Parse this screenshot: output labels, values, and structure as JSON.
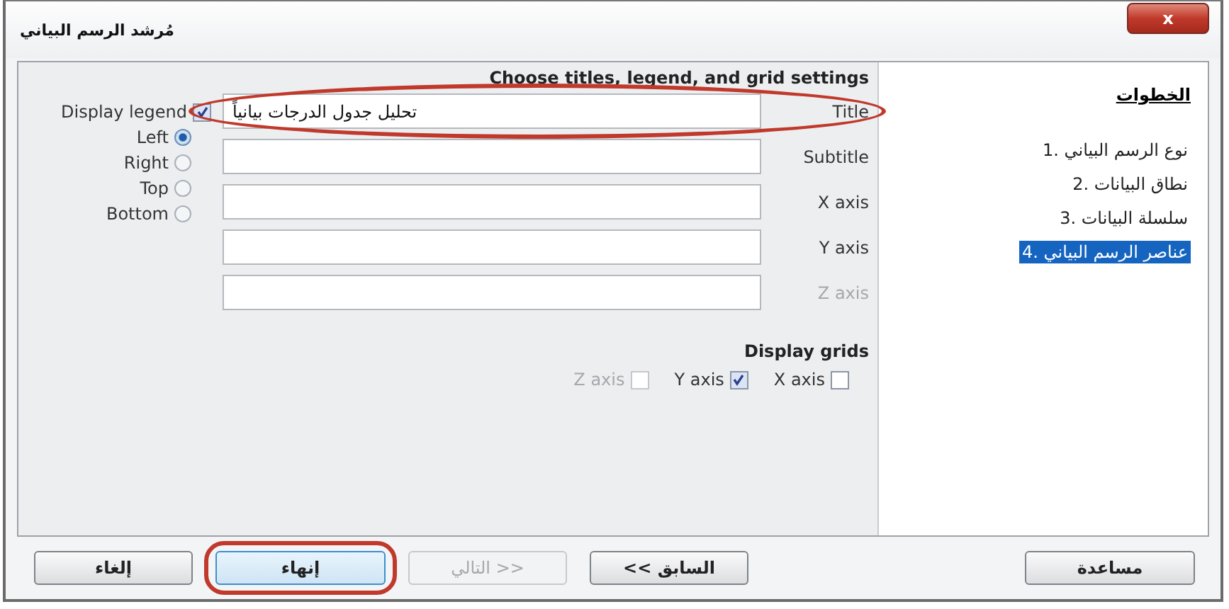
{
  "window": {
    "title": "مُرشد الرسم البياني",
    "close": "x"
  },
  "heading": "Choose titles, legend, and grid settings",
  "legend": {
    "label": "Display legend",
    "checked": true,
    "positions": [
      {
        "label": "Left",
        "selected": true
      },
      {
        "label": "Right",
        "selected": false
      },
      {
        "label": "Top",
        "selected": false
      },
      {
        "label": "Bottom",
        "selected": false
      }
    ]
  },
  "fields": [
    {
      "label": "Title",
      "value": "تحليل جدول الدرجات بيانياً",
      "disabled": false,
      "annotated": true
    },
    {
      "label": "Subtitle",
      "disabled": false,
      "annotated": false
    },
    {
      "label": "X axis",
      "disabled": false,
      "annotated": false
    },
    {
      "label": "Y axis",
      "disabled": false,
      "annotated": false
    },
    {
      "label": "Z axis",
      "disabled": true,
      "annotated": false
    }
  ],
  "grids": {
    "heading": "Display grids",
    "items": [
      {
        "label": "X axis",
        "checked": false,
        "disabled": false
      },
      {
        "label": "Y axis",
        "checked": true,
        "disabled": false
      },
      {
        "label": "Z axis",
        "checked": false,
        "disabled": true
      }
    ]
  },
  "steps": {
    "heading": "الخطوات",
    "items": [
      {
        "label": "1. نوع الرسم البياني",
        "selected": false
      },
      {
        "label": "2. نطاق البيانات",
        "selected": false
      },
      {
        "label": "3. سلسلة البيانات",
        "selected": false
      },
      {
        "label": "4. عناصر الرسم البياني",
        "selected": true
      }
    ]
  },
  "buttons": [
    {
      "label": "<< السابق",
      "disabled": false,
      "annotated": false
    },
    {
      "label": "التالي >>",
      "disabled": true,
      "annotated": false
    },
    {
      "label": "إنهاء",
      "disabled": false,
      "annotated": true
    },
    {
      "label": "إلغاء",
      "disabled": false,
      "annotated": false
    }
  ],
  "help_button": {
    "label": "مساعدة"
  }
}
